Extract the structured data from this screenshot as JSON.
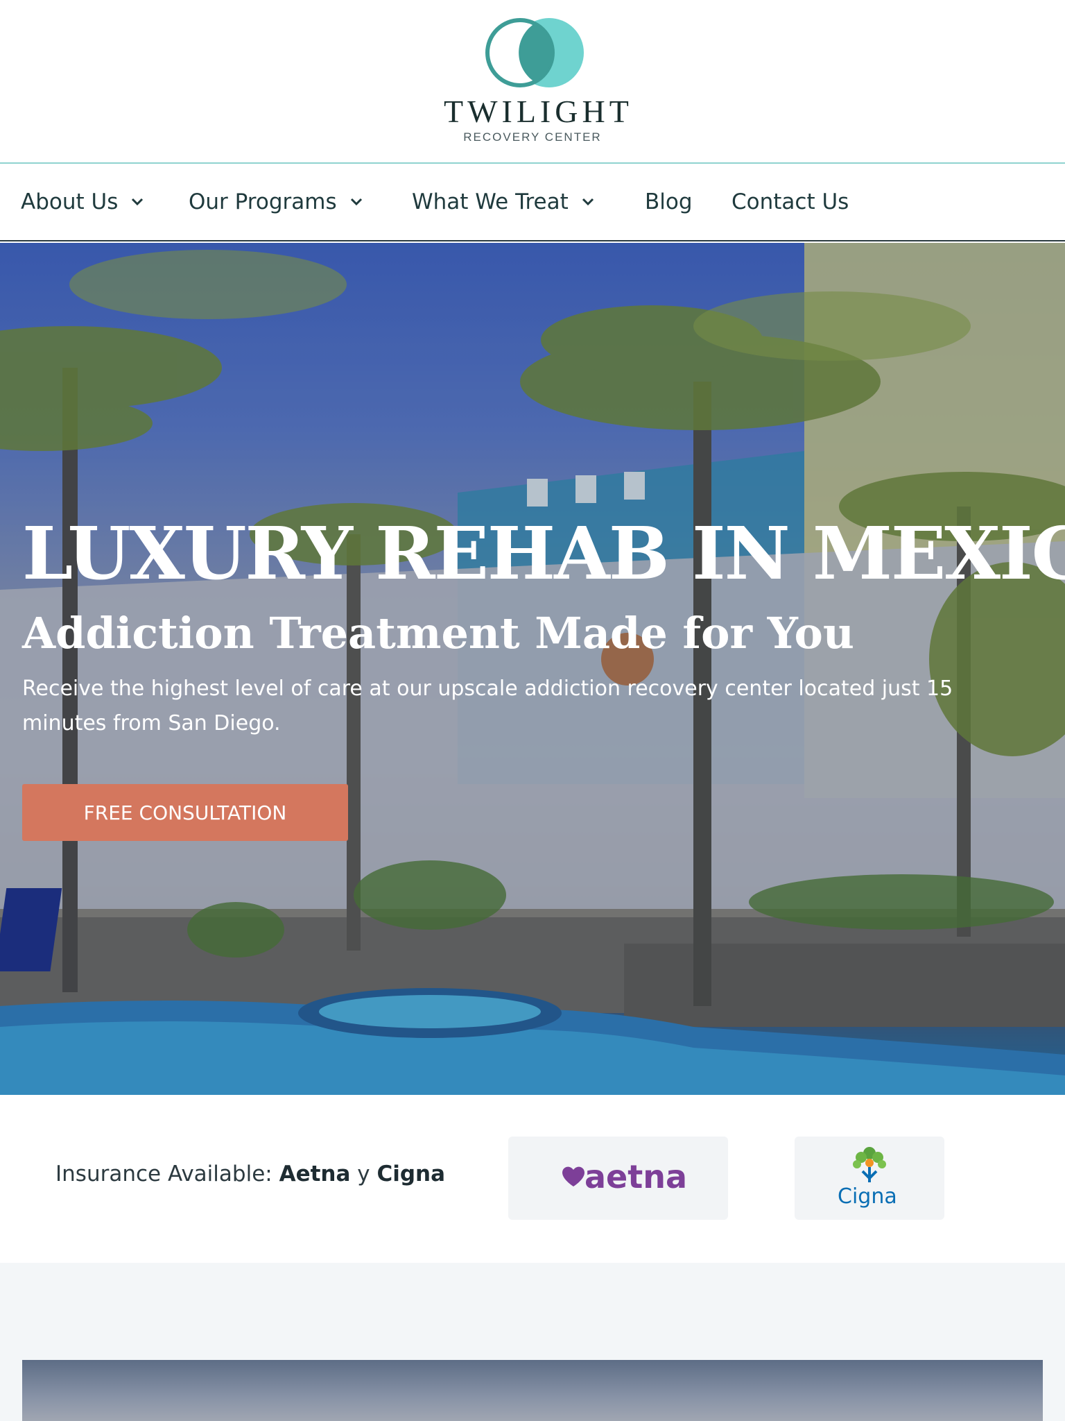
{
  "brand": {
    "name": "TWILIGHT",
    "tagline": "RECOVERY CENTER",
    "colors": {
      "teal_dark": "#3e9d97",
      "teal_light": "#6fd3cf"
    }
  },
  "nav": {
    "items": [
      {
        "label": "About Us",
        "has_dropdown": true
      },
      {
        "label": "Our Programs",
        "has_dropdown": true
      },
      {
        "label": "What We Treat",
        "has_dropdown": true
      },
      {
        "label": "Blog",
        "has_dropdown": false
      },
      {
        "label": "Contact Us",
        "has_dropdown": false
      }
    ]
  },
  "hero": {
    "title": "LUXURY REHAB IN MEXICO",
    "subtitle": "Addiction Treatment Made for You",
    "description": "Receive the highest level of care at our upscale addiction recovery center located just 15 minutes from San Diego.",
    "cta_label": "FREE CONSULTATION",
    "cta_color": "#d4775e"
  },
  "insurance": {
    "prefix": "Insurance Available: ",
    "provider_1": "Aetna",
    "joiner": " y ",
    "provider_2": "Cigna",
    "logos": [
      {
        "name": "aetna",
        "text": "aetna",
        "color": "#7d3f98"
      },
      {
        "name": "cigna",
        "text": "Cigna",
        "color": "#0a6eb4"
      }
    ]
  }
}
